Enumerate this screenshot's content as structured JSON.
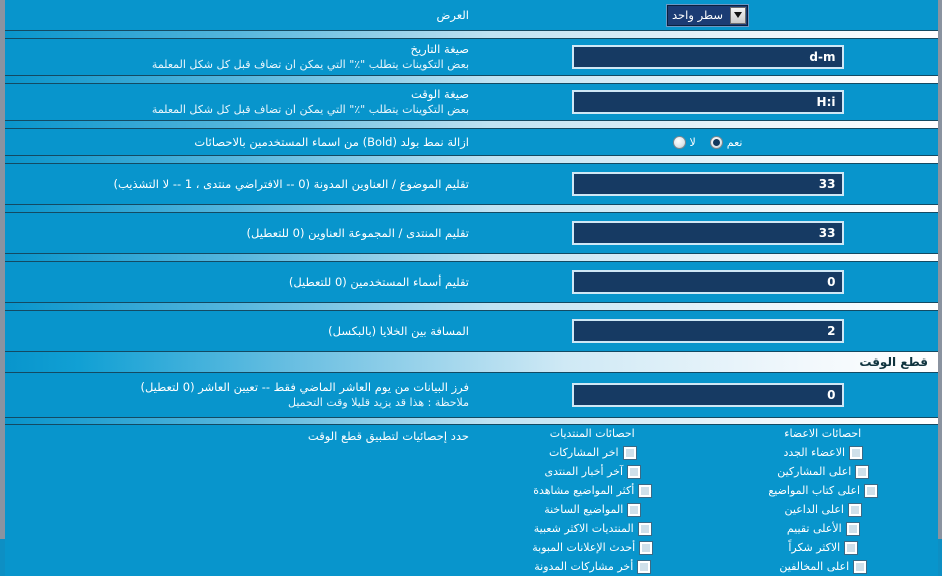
{
  "colors": {
    "background": "#0895cc",
    "input_fill": "#163a63",
    "input_border": "#cfe7f5",
    "frame": "#8a93a0",
    "header_text": "#10343f"
  },
  "rows": [
    {
      "label": "العرض",
      "desc": "",
      "control": "select",
      "value": "سطر واحد"
    },
    {
      "label": "صيغة التاريخ",
      "desc": "بعض التكوينات يتطلب \"٪\" التي يمكن ان تضاف قبل كل شكل المعلمة",
      "control": "text",
      "value": "d-m"
    },
    {
      "label": "صيغة الوقت",
      "desc": "بعض التكوينات يتطلب \"٪\" التي يمكن ان تضاف قبل كل شكل المعلمة",
      "control": "text",
      "value": "H:i"
    },
    {
      "label": "ازالة نمط بولد (Bold) من اسماء المستخدمين بالاحصائات",
      "desc": "",
      "control": "radio",
      "value": "نعم"
    },
    {
      "label": "تقليم الموضوع / العناوين المدونة (0 -- الافتراضي منتدى ، 1 -- لا التشذيب)",
      "desc": "",
      "control": "text",
      "value": "33"
    },
    {
      "label": "تقليم المنتدى / المجموعة العناوين (0 للتعطيل)",
      "desc": "",
      "control": "text",
      "value": "33"
    },
    {
      "label": "تقليم أسماء المستخدمين (0 للتعطيل)",
      "desc": "",
      "control": "text",
      "value": "0"
    },
    {
      "label": "المسافة بين الخلايا (بالبكسل)",
      "desc": "",
      "control": "text",
      "value": "2"
    }
  ],
  "radio_options": {
    "yes": "نعم",
    "no": "لا"
  },
  "section": {
    "title": "قطع الوقت",
    "cutoff_row": {
      "label": "فرز البيانات من يوم العاشر الماضي فقط -- تعيين العاشر (0 لتعطيل)",
      "desc": "ملاحظة : هذا قد يزيد قليلا وقت التحميل",
      "value": "0"
    },
    "stats_label": "حدد إحصائيات لتطبيق قطع الوقت",
    "columns": [
      {
        "head": "احصائات المنتديات",
        "items": [
          "اخر المشاركات",
          "آخر أخبار المنتدى",
          "أكثر المواضيع مشاهدة",
          "المواضيع الساخنة",
          "المنتديات الاكثر شعبية",
          "أحدث الإعلانات المبوبة",
          "أخر مشاركات المدونة"
        ]
      },
      {
        "head": "احصائات الاعضاء",
        "items": [
          "الاعضاء الجدد",
          "اعلى المشاركين",
          "اعلى كتاب المواضيع",
          "اعلى الداعين",
          "الأعلى تقييم",
          "الاكثر شكراً",
          "اعلى المخالفين"
        ]
      }
    ]
  }
}
